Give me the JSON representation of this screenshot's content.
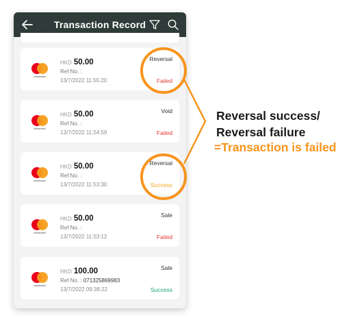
{
  "header": {
    "title": "Transaction Record",
    "back_icon": "back-arrow-icon",
    "filter_icon": "filter-icon",
    "search_icon": "search-icon"
  },
  "colors": {
    "header_bg": "#2e3b38",
    "failed": "#e53935",
    "success_orange": "#f5a623",
    "success_green": "#1aa37a",
    "annotation": "#f7941d"
  },
  "transactions": [
    {
      "currency": "HKD",
      "amount": "50.00",
      "ref_label": "Ref No. :",
      "ref_value": "",
      "date": "13/7/2022 11:55:20",
      "type": "Reversal",
      "status": "Failed",
      "status_color": "#e53935",
      "card_brand": "mastercard"
    },
    {
      "currency": "HKD",
      "amount": "50.00",
      "ref_label": "Ref No. :",
      "ref_value": "",
      "date": "13/7/2022 11:54:59",
      "type": "Void",
      "status": "Failed",
      "status_color": "#e53935",
      "card_brand": "mastercard"
    },
    {
      "currency": "HKD",
      "amount": "50.00",
      "ref_label": "Ref No. :",
      "ref_value": "",
      "date": "13/7/2022 11:53:30",
      "type": "Reversal",
      "status": "Success",
      "status_color": "#f5a623",
      "card_brand": "mastercard"
    },
    {
      "currency": "HKD",
      "amount": "50.00",
      "ref_label": "Ref No. :",
      "ref_value": "",
      "date": "13/7/2022 11:53:12",
      "type": "Sale",
      "status": "Failed",
      "status_color": "#e53935",
      "card_brand": "mastercard"
    },
    {
      "currency": "HKD",
      "amount": "100.00",
      "ref_label": "Ref No. :",
      "ref_value": "071325869983",
      "date": "13/7/2022 09:38:22",
      "type": "Sale",
      "status": "Success",
      "status_color": "#1aa37a",
      "card_brand": "mastercard"
    }
  ],
  "annotation": {
    "line1": "Reversal success/",
    "line2": "Reversal failure",
    "line3": "=Transaction is failed"
  }
}
